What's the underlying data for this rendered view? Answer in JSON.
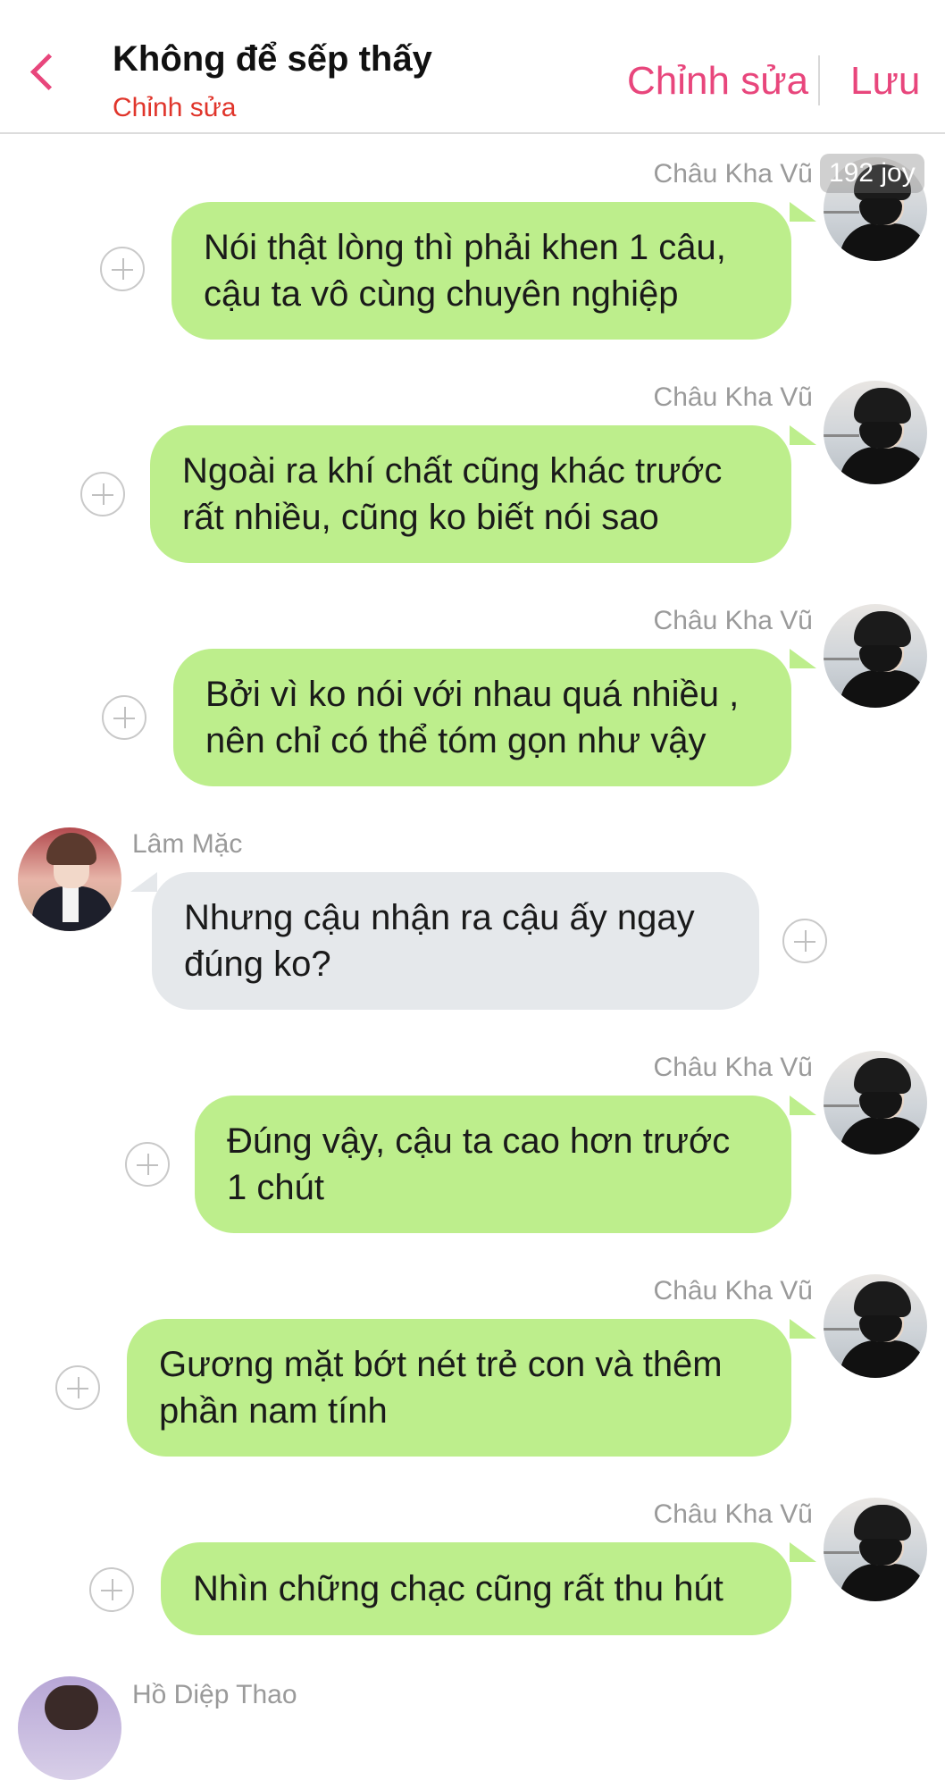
{
  "header": {
    "title": "Không để sếp thấy",
    "subtitle": "Chỉnh sửa",
    "edit_label": "Chỉnh sửa",
    "save_label": "Lưu"
  },
  "watermark": "192 joy",
  "messages": [
    {
      "sender": "Châu Kha Vũ",
      "side": "right",
      "lines": [
        "Nói thật lòng thì phải khen 1 câu,",
        "cậu ta vô cùng chuyên nghiệp"
      ]
    },
    {
      "sender": "Châu Kha Vũ",
      "side": "right",
      "lines": [
        "Ngoài ra khí chất cũng khác trước",
        "rất nhiều, cũng ko biết nói sao"
      ]
    },
    {
      "sender": "Châu Kha Vũ",
      "side": "right",
      "lines": [
        "Bởi vì ko nói với nhau quá nhiều ,",
        "nên chỉ có thể tóm gọn như vậy"
      ]
    },
    {
      "sender": "Lâm Mặc",
      "side": "left",
      "lines": [
        "Nhưng cậu nhận ra cậu ấy ngay",
        "đúng ko?"
      ]
    },
    {
      "sender": "Châu Kha Vũ",
      "side": "right",
      "lines": [
        "Đúng vậy, cậu ta cao hơn trước",
        "1 chút"
      ]
    },
    {
      "sender": "Châu Kha Vũ",
      "side": "right",
      "lines": [
        "Gương mặt bớt nét trẻ con và thêm",
        "phần nam tính"
      ]
    },
    {
      "sender": "Châu Kha Vũ",
      "side": "right",
      "lines": [
        "Nhìn chững chạc cũng rất thu hút"
      ]
    },
    {
      "sender": "Hồ Diệp Thao",
      "side": "left",
      "lines": []
    }
  ],
  "colors": {
    "accent": "#e8467c",
    "subtitle": "#e0352b",
    "green_bubble": "#bdee8c",
    "gray_bubble": "#e5e8eb"
  }
}
